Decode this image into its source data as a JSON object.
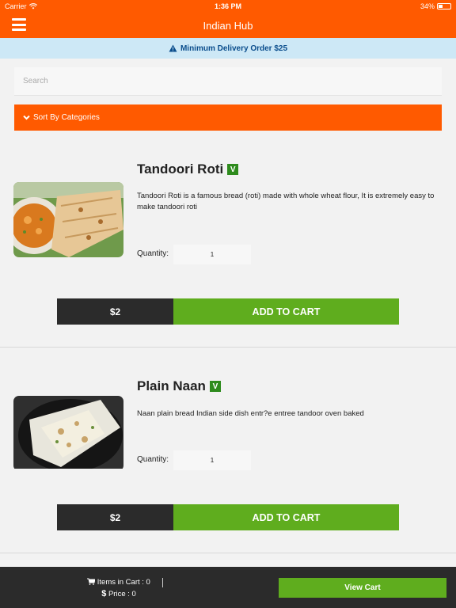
{
  "status": {
    "carrier": "Carrier",
    "time": "1:36 PM",
    "battery": "34%",
    "battery_level": 0.34
  },
  "header": {
    "title": "Indian Hub"
  },
  "notice": {
    "text": "Minimum Delivery Order $25"
  },
  "search": {
    "placeholder": "Search"
  },
  "sort": {
    "label": "Sort By Categories"
  },
  "items": [
    {
      "name": "Tandoori Roti",
      "veg_badge": "V",
      "description": "Tandoori Roti is a famous bread (roti) made with whole wheat flour, It is extremely easy to make tandoori roti",
      "quantity_label": "Quantity:",
      "quantity": "1",
      "price": "$2",
      "add_label": "ADD TO CART"
    },
    {
      "name": "Plain Naan",
      "veg_badge": "V",
      "description": "Naan plain bread Indian side dish entr?e entree tandoor oven baked",
      "quantity_label": "Quantity:",
      "quantity": "1",
      "price": "$2",
      "add_label": "ADD TO CART"
    }
  ],
  "footer": {
    "items_in_cart": "Items in Cart : 0",
    "price": "Price : 0",
    "view_cart": "View Cart"
  },
  "colors": {
    "brand": "#ff5a00",
    "accent_green": "#5fad1e",
    "dark": "#2b2b2b",
    "notice_bg": "#cde8f6"
  }
}
